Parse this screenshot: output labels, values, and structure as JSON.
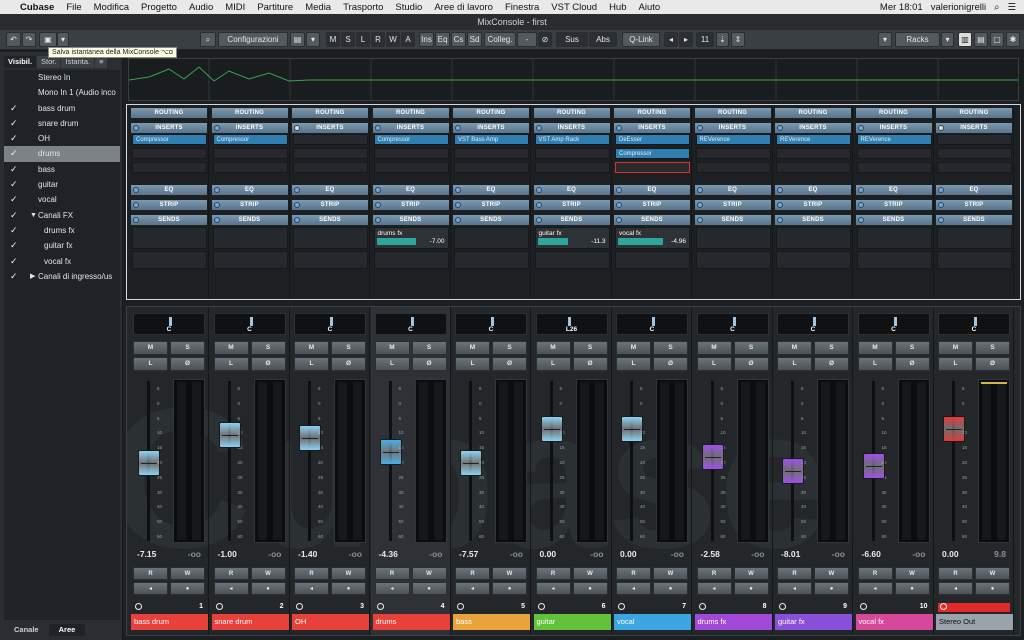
{
  "menubar": {
    "app": "Cubase",
    "items": [
      "File",
      "Modifica",
      "Progetto",
      "Audio",
      "MIDI",
      "Partiture",
      "Media",
      "Trasporto",
      "Studio",
      "Aree di lavoro",
      "Finestra",
      "VST Cloud",
      "Hub",
      "Aiuto"
    ],
    "clock": "Mer 18:01",
    "user": "valerionigrelli"
  },
  "window": {
    "title": "MixConsole - first"
  },
  "toolbar": {
    "configurazioni": "Configurazioni",
    "m": "M",
    "s": "S",
    "l": "L",
    "r": "R",
    "w": "W",
    "a": "A",
    "ins": "Ins",
    "eq": "Eq",
    "cs": "Cs",
    "sd": "Sd",
    "colleg": "Colleg.",
    "dash": "-",
    "sus": "Sus",
    "abs": "Abs",
    "qlink": "Q-Link",
    "count": "11",
    "racks": "Racks"
  },
  "tooltip": "Salva istantanea della MixConsole ⌥ɑ",
  "left_panel": {
    "tabs": [
      "Visibil.",
      "Stor.",
      "Istanta.",
      "≡"
    ],
    "items": [
      {
        "label": "Stereo In",
        "check": "",
        "sel": false,
        "sub": false,
        "tri": ""
      },
      {
        "label": "Mono In 1 (Audio inco",
        "check": "",
        "sel": false,
        "sub": false,
        "tri": ""
      },
      {
        "label": "bass drum",
        "check": "✓",
        "sel": false,
        "sub": false,
        "tri": ""
      },
      {
        "label": "snare drum",
        "check": "✓",
        "sel": false,
        "sub": false,
        "tri": ""
      },
      {
        "label": "OH",
        "check": "✓",
        "sel": false,
        "sub": false,
        "tri": ""
      },
      {
        "label": "drums",
        "check": "✓",
        "sel": true,
        "sub": false,
        "tri": ""
      },
      {
        "label": "bass",
        "check": "✓",
        "sel": false,
        "sub": false,
        "tri": ""
      },
      {
        "label": "guitar",
        "check": "✓",
        "sel": false,
        "sub": false,
        "tri": ""
      },
      {
        "label": "vocal",
        "check": "✓",
        "sel": false,
        "sub": false,
        "tri": ""
      },
      {
        "label": "Canali FX",
        "check": "✓",
        "sel": false,
        "sub": false,
        "tri": "▼"
      },
      {
        "label": "drums fx",
        "check": "✓",
        "sel": false,
        "sub": true,
        "tri": ""
      },
      {
        "label": "guitar fx",
        "check": "✓",
        "sel": false,
        "sub": true,
        "tri": ""
      },
      {
        "label": "vocal fx",
        "check": "✓",
        "sel": false,
        "sub": true,
        "tri": ""
      },
      {
        "label": "Canali di ingresso/us",
        "check": "✓",
        "sel": false,
        "sub": false,
        "tri": "▶"
      }
    ],
    "bottom_tabs": [
      "Canale",
      "Aree"
    ]
  },
  "rack_labels": {
    "routing": "ROUTING",
    "inserts": "INSERTS",
    "eq": "EQ",
    "strip": "STRIP",
    "sends": "SENDS"
  },
  "channels": [
    {
      "name": "bass drum",
      "num": "1",
      "color": "#e8413c",
      "fader_color": "#8fd0f0",
      "fader_level": 0.48,
      "pan": "C",
      "pan_pos": 0.5,
      "value": "-7.15",
      "peak": "-oo",
      "insert_led": true,
      "inserts": [
        "Compressor"
      ],
      "send": null,
      "link": false
    },
    {
      "name": "snare drum",
      "num": "2",
      "color": "#e8413c",
      "fader_color": "#8fd0f0",
      "fader_level": 0.68,
      "pan": "C",
      "pan_pos": 0.5,
      "value": "-1.00",
      "peak": "-oo",
      "insert_led": true,
      "inserts": [
        "Compressor"
      ],
      "send": null,
      "link": false
    },
    {
      "name": "OH",
      "num": "3",
      "color": "#e8413c",
      "fader_color": "#8fd0f0",
      "fader_level": 0.66,
      "pan": "C",
      "pan_pos": 0.5,
      "value": "-1.40",
      "peak": "-oo",
      "insert_led": false,
      "inserts": [],
      "send": null,
      "link": false
    },
    {
      "name": "drums",
      "num": "4",
      "color": "#e8413c",
      "fader_color": "#4aaee6",
      "fader_level": 0.56,
      "pan": "C",
      "pan_pos": 0.5,
      "value": "-4.36",
      "peak": "-oo",
      "insert_led": true,
      "inserts": [
        "Compressor"
      ],
      "send": {
        "name": "drums fx",
        "value": "-7.00",
        "level": 0.55
      },
      "link": true
    },
    {
      "name": "bass",
      "num": "5",
      "color": "#e8a33c",
      "fader_color": "#8fd0f0",
      "fader_level": 0.48,
      "pan": "C",
      "pan_pos": 0.5,
      "value": "-7.57",
      "peak": "-oo",
      "insert_led": true,
      "inserts": [
        "VST Bass Amp"
      ],
      "send": null,
      "link": false
    },
    {
      "name": "guitar",
      "num": "6",
      "color": "#63c13c",
      "fader_color": "#8fd0f0",
      "fader_level": 0.72,
      "pan": "L26",
      "pan_pos": 0.45,
      "value": "0.00",
      "peak": "-oo",
      "insert_led": true,
      "inserts": [
        "VST Amp Rack"
      ],
      "send": {
        "name": "guitar fx",
        "value": "-11.3",
        "level": 0.42
      },
      "link": false
    },
    {
      "name": "vocal",
      "num": "7",
      "color": "#3ba6df",
      "fader_color": "#8fd0f0",
      "fader_level": 0.72,
      "pan": "C",
      "pan_pos": 0.5,
      "value": "0.00",
      "peak": "-oo",
      "insert_led": true,
      "inserts": [
        "DeEsser",
        "Compressor"
      ],
      "send": {
        "name": "vocal fx",
        "value": "-4.96",
        "level": 0.62
      },
      "link": false
    },
    {
      "name": "drums fx",
      "num": "8",
      "color": "#a048d8",
      "fader_color": "#a050e8",
      "fader_level": 0.52,
      "pan": "C",
      "pan_pos": 0.5,
      "value": "-2.58",
      "peak": "-oo",
      "insert_led": true,
      "inserts": [
        "REVerence"
      ],
      "send": null,
      "link": true
    },
    {
      "name": "guitar fx",
      "num": "9",
      "color": "#8a4fd8",
      "fader_color": "#a050e8",
      "fader_level": 0.42,
      "pan": "C",
      "pan_pos": 0.5,
      "value": "-8.01",
      "peak": "-oo",
      "insert_led": true,
      "inserts": [
        "REVerence"
      ],
      "send": null,
      "link": true
    },
    {
      "name": "vocal fx",
      "num": "10",
      "color": "#d8489a",
      "fader_color": "#a050e8",
      "fader_level": 0.46,
      "pan": "C",
      "pan_pos": 0.5,
      "value": "-6.60",
      "peak": "-oo",
      "insert_led": true,
      "inserts": [
        "REVerence"
      ],
      "send": null,
      "link": true
    },
    {
      "name": "Stereo Out",
      "num": "",
      "color": "#9aa3aa",
      "fader_color": "#e23a3a",
      "fader_level": 0.72,
      "pan": "C",
      "pan_pos": 0.5,
      "value": "0.00",
      "peak": "9.8",
      "insert_led": false,
      "inserts": [],
      "send": null,
      "link": false,
      "out": true
    }
  ],
  "scale": [
    "6",
    "0",
    "5",
    "10",
    "15",
    "20",
    "25",
    "30",
    "40",
    "50",
    "60"
  ],
  "buttons": {
    "m": "M",
    "s": "S",
    "l": "L",
    "phase": "Ø",
    "r": "R",
    "w": "W"
  }
}
